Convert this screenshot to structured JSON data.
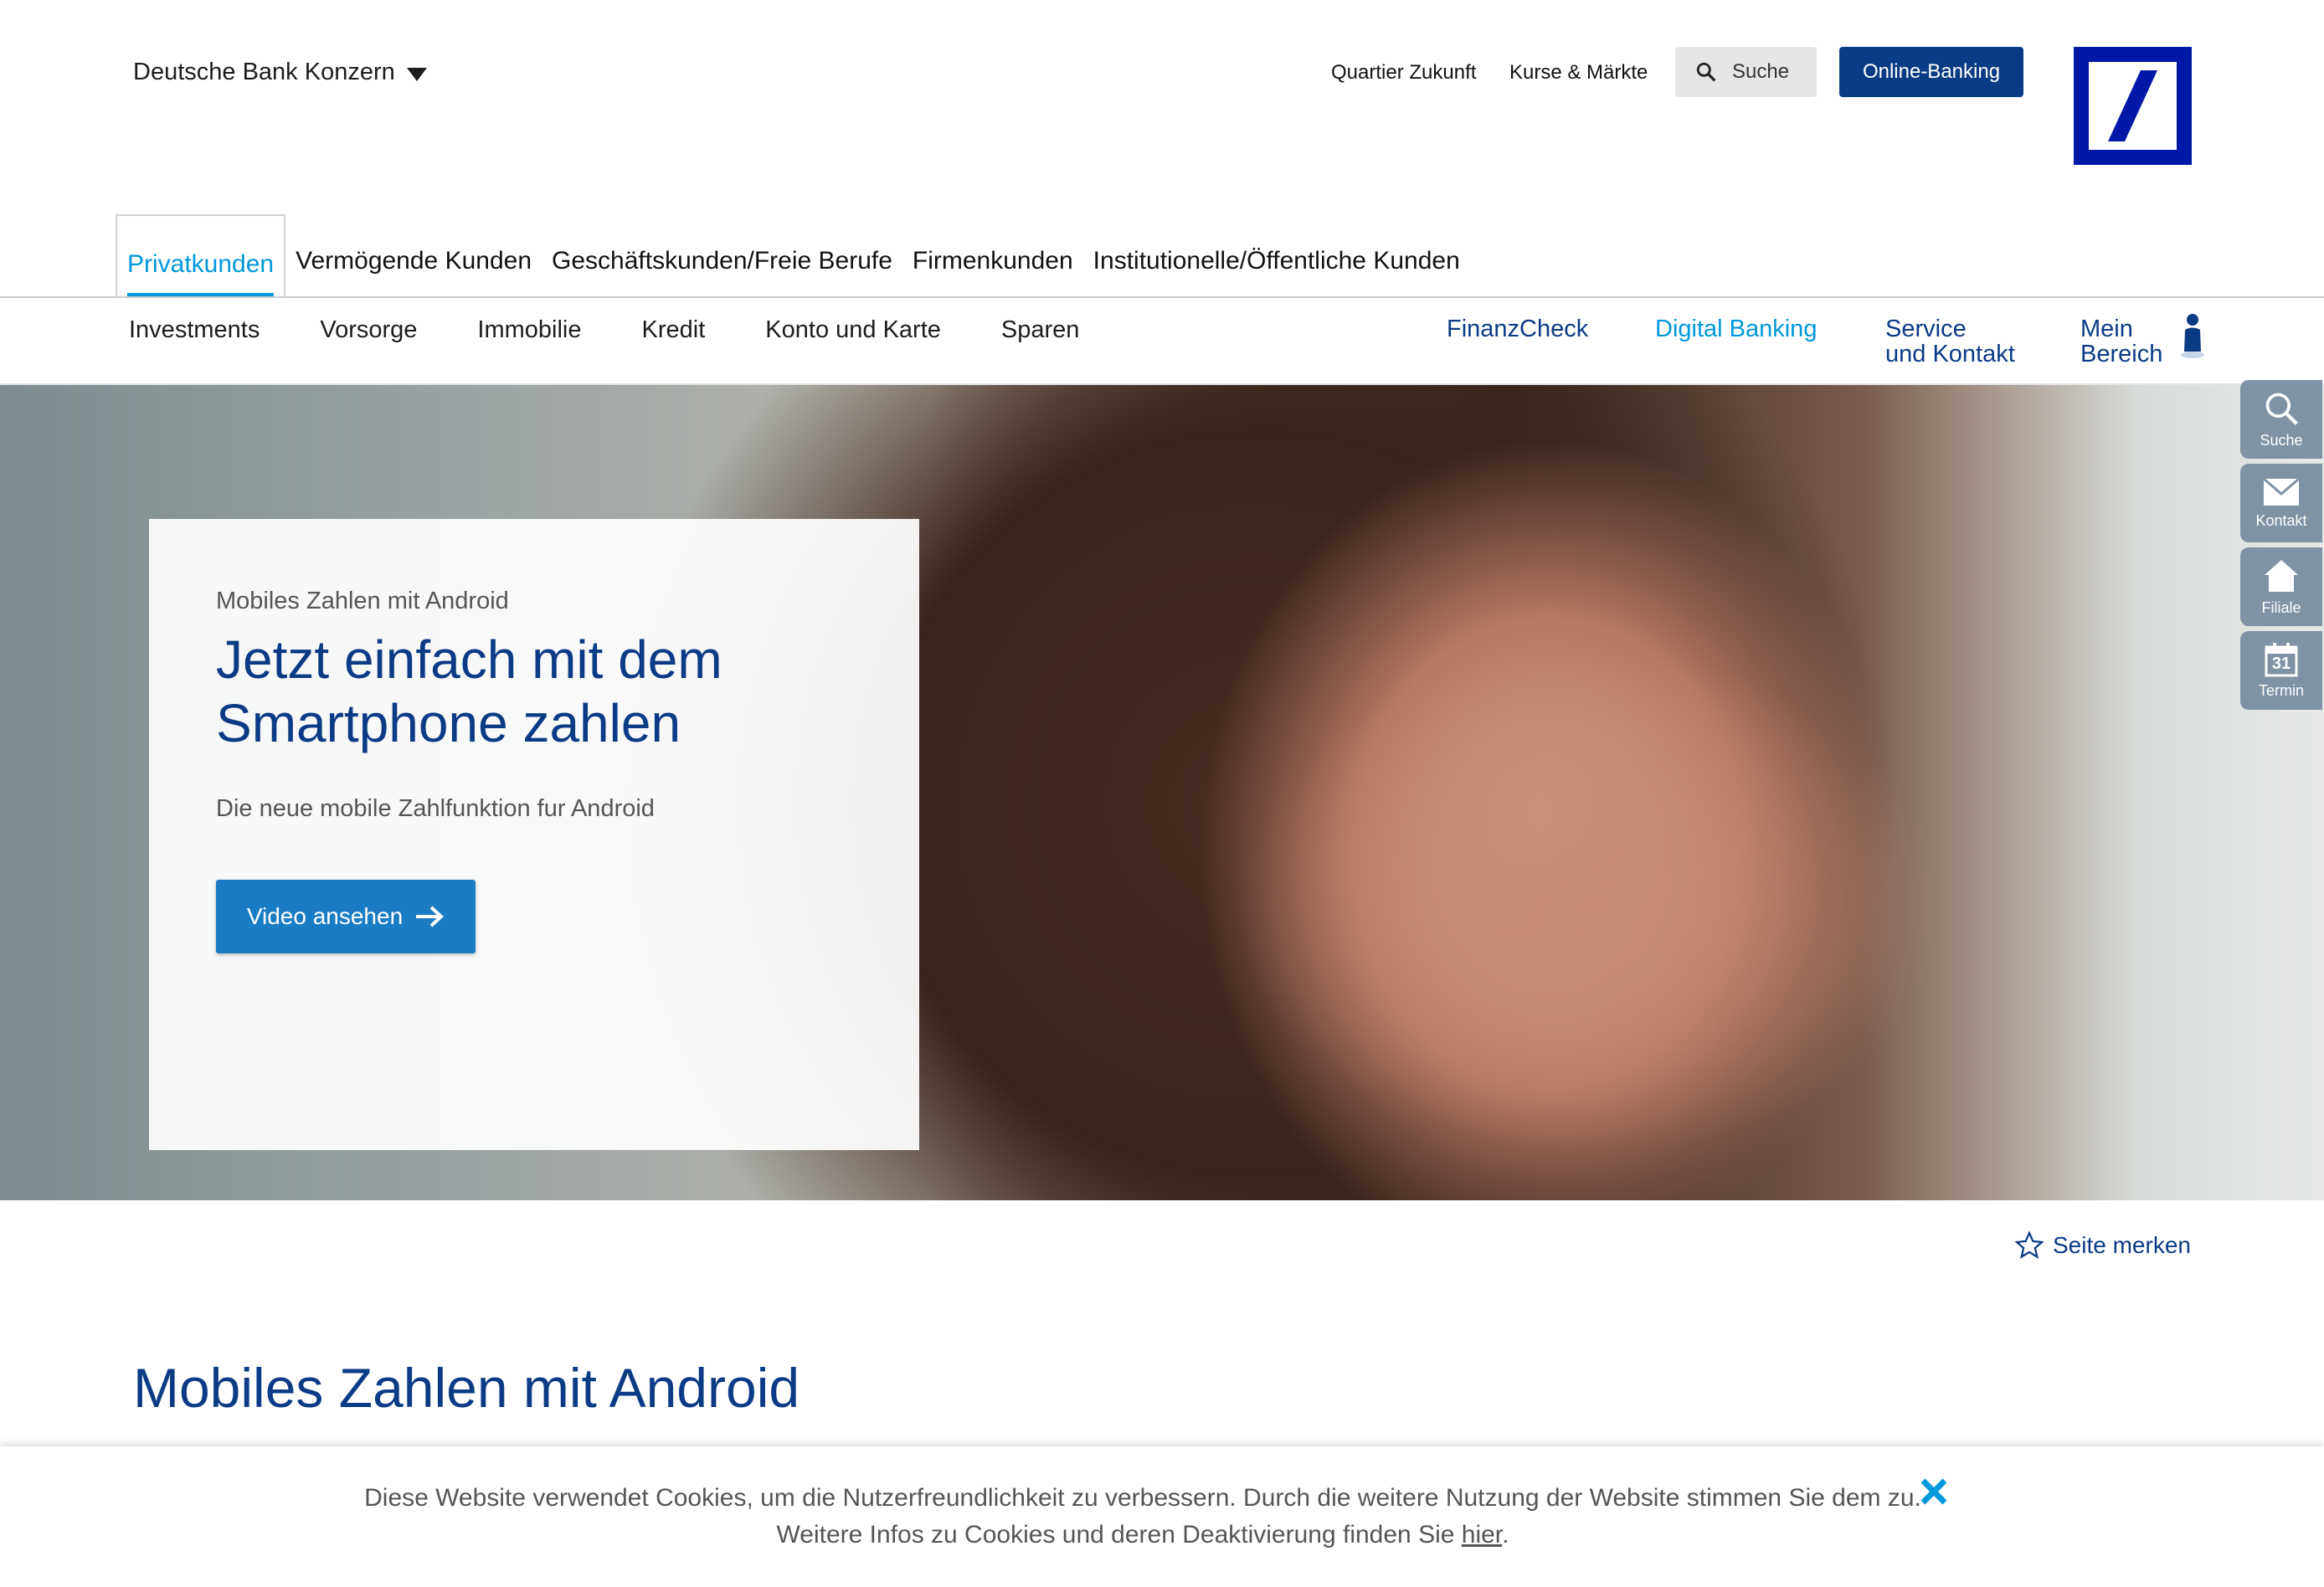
{
  "header": {
    "group_label": "Deutsche Bank Konzern",
    "util_links": [
      "Quartier Zukunft",
      "Kurse & Märkte"
    ],
    "search_label": "Suche",
    "online_banking_label": "Online-Banking"
  },
  "segments": [
    "Privatkunden",
    "Vermögende Kunden",
    "Geschäftskunden/Freie Berufe",
    "Firmenkunden",
    "Institutionelle/Öffentliche Kunden"
  ],
  "nav": {
    "items": [
      "Investments",
      "Vorsorge",
      "Immobilie",
      "Kredit",
      "Konto und Karte",
      "Sparen"
    ],
    "finanzcheck": "FinanzCheck",
    "digital_banking": "Digital Banking",
    "service_line1": "Service",
    "service_line2": "und Kontakt",
    "mein_line1": "Mein",
    "mein_line2": "Bereich"
  },
  "hero": {
    "eyebrow": "Mobiles Zahlen mit Android",
    "title": "Jetzt einfach mit dem Smartphone zahlen",
    "subtitle": "Die neue mobile Zahlfunktion fur Android",
    "button": "Video ansehen"
  },
  "sidebar": {
    "suche": "Suche",
    "kontakt": "Kontakt",
    "filiale": "Filiale",
    "termin": "Termin",
    "termin_day": "31"
  },
  "bookmark_label": "Seite merken",
  "section_title": "Mobiles Zahlen mit Android",
  "cookie": {
    "text_before": "Diese Website verwendet Cookies, um die Nutzerfreundlichkeit zu verbessern. Durch die weitere Nutzung der Website stimmen Sie dem zu. Weitere Infos zu Cookies und deren Deaktivierung finden Sie ",
    "link": "hier",
    "text_after": "."
  },
  "colors": {
    "brand_blue": "#0018a8",
    "navy": "#0b3b85",
    "accent": "#0098db",
    "button_blue": "#1a7dc4",
    "sidebar_gray": "#8092a6"
  }
}
